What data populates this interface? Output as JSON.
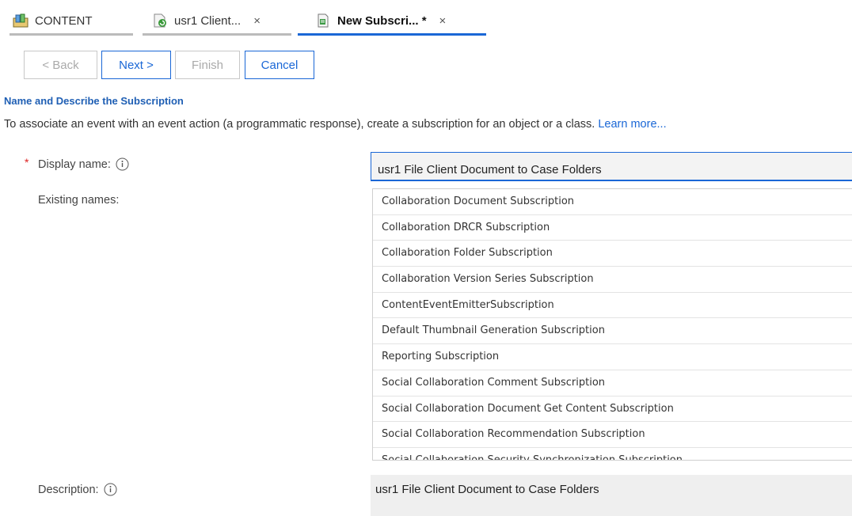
{
  "tabs": [
    {
      "label": "CONTENT",
      "icon": "content-icon",
      "closable": false,
      "active": false
    },
    {
      "label": "usr1 Client...",
      "icon": "document-refresh-icon",
      "closable": true,
      "active": false
    },
    {
      "label": "New Subscri... *",
      "icon": "subscription-icon",
      "closable": true,
      "active": true
    }
  ],
  "tab_close_glyph": "×",
  "wizard": {
    "back_label": "< Back",
    "next_label": "Next >",
    "finish_label": "Finish",
    "cancel_label": "Cancel"
  },
  "section_title": "Name and Describe the Subscription",
  "intro": {
    "text": "To associate an event with an event action (a programmatic response), create a subscription for an object or a class. ",
    "link": "Learn more..."
  },
  "form": {
    "required_marker": "*",
    "display_name_label": "Display name:",
    "display_name_value": "usr1 File Client Document to Case Folders",
    "existing_names_label": "Existing names:",
    "existing_names": [
      "Collaboration Document Subscription",
      "Collaboration DRCR Subscription",
      "Collaboration Folder Subscription",
      "Collaboration Version Series Subscription",
      "ContentEventEmitterSubscription",
      "Default Thumbnail Generation Subscription",
      "Reporting Subscription",
      "Social Collaboration Comment Subscription",
      "Social Collaboration Document Get Content Subscription",
      "Social Collaboration Recommendation Subscription",
      "Social Collaboration Security Synchronization Subscription"
    ],
    "description_label": "Description:",
    "description_value": "usr1 File Client Document to Case Folders"
  },
  "colors": {
    "accent": "#1a67d6",
    "section_title": "#1f5fb4",
    "required": "#d22222"
  }
}
